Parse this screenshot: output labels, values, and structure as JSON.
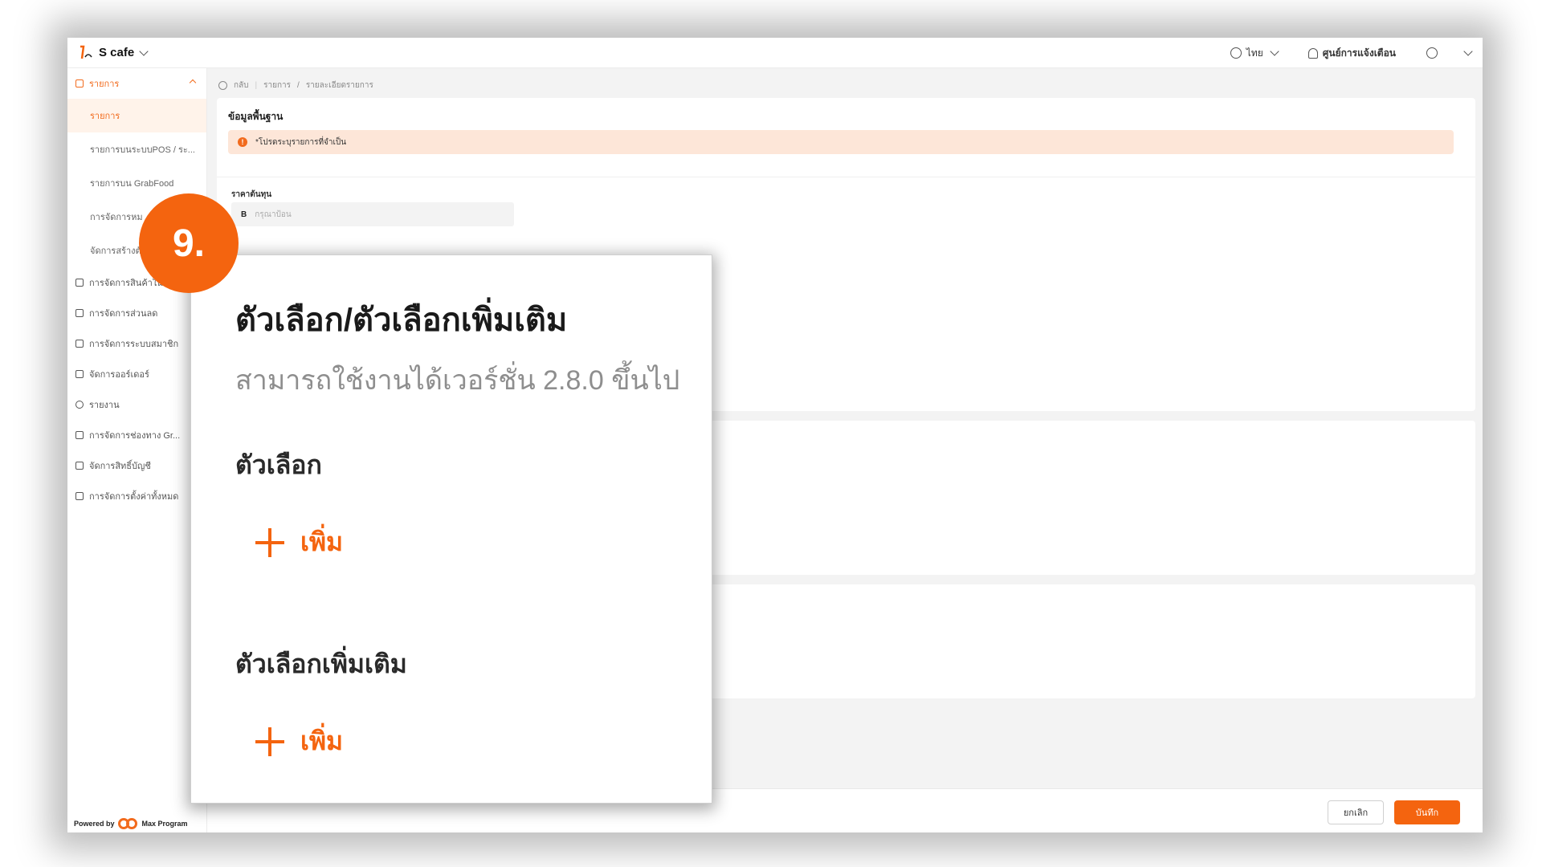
{
  "app": {
    "name": "S cafe"
  },
  "topbar": {
    "language": "ไทย",
    "notifications_label": "ศูนย์การแจ้งเตือน"
  },
  "sidebar": {
    "group_active": "รายการ",
    "subitems": [
      "รายการ",
      "รายการบนระบบPOS / ระ...",
      "รายการบน GrabFood",
      "การจัดการหม",
      "จัดการสร้างตั"
    ],
    "groups": [
      "การจัดการสินค้าในสต",
      "การจัดการส่วนลด",
      "การจัดการระบบสมาชิก",
      "จัดการออร์เดอร์",
      "รายงาน",
      "การจัดการช่องทาง Gr...",
      "จัดการสิทธิ์บัญชี",
      "การจัดการตั้งค่าทั้งหมด"
    ],
    "powered_by": "Powered by",
    "program_name": "Max Program"
  },
  "breadcrumb": {
    "back": "กลับ",
    "items": [
      "รายการ",
      "/",
      "รายละเอียดรายการ"
    ]
  },
  "basic_info": {
    "title": "ข้อมูลพื้นฐาน",
    "warning": "*โปรดระบุรายการที่จำเป็น",
    "cost_label": "ราคาต้นทุน",
    "currency": "B",
    "cost_placeholder": "กรุณาป้อน"
  },
  "footer": {
    "cancel": "ยกเลิก",
    "save": "บันทึก"
  },
  "zoom": {
    "step": "9.",
    "title": "ตัวเลือก/ตัวเลือกเพิ่มเติม",
    "subtitle": "สามารถใช้งานได้เวอร์ชั่น 2.8.0 ขึ้นไป",
    "options_heading": "ตัวเลือก",
    "extra_heading": "ตัวเลือกเพิ่มเติม",
    "add_label": "เพิ่ม"
  },
  "colors": {
    "accent": "#f4640f",
    "warning_bg": "#fde6d8"
  }
}
